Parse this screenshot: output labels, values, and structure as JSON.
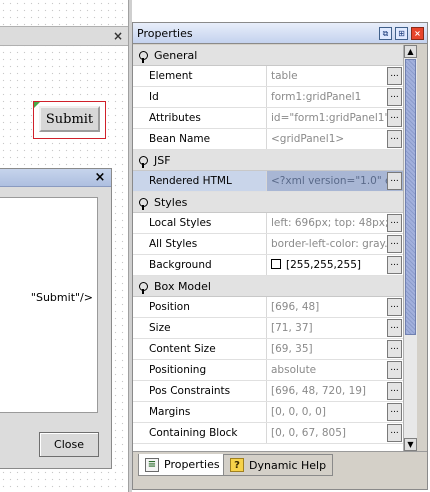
{
  "designer": {
    "close_glyph": "×",
    "submit_label": "Submit"
  },
  "dialog": {
    "close_glyph": "×",
    "code_text": "\"Submit\"/>",
    "close_button_label": "Close"
  },
  "panel": {
    "title": "Properties",
    "window_buttons": {
      "restore": "⧉",
      "float": "⊞",
      "close": "×"
    },
    "categories": [
      {
        "label": "General",
        "rows": [
          {
            "name": "Element",
            "value": "table"
          },
          {
            "name": "Id",
            "value": "form1:gridPanel1"
          },
          {
            "name": "Attributes",
            "value": "id=\"form1:gridPanel1\",..."
          },
          {
            "name": "Bean Name",
            "value": "<gridPanel1>"
          }
        ]
      },
      {
        "label": "JSF",
        "rows": [
          {
            "name": "Rendered HTML",
            "value": "<?xml version=\"1.0\" e..."
          }
        ]
      },
      {
        "label": "Styles",
        "rows": [
          {
            "name": "Local Styles",
            "value": "left: 696px; top: 48px; ..."
          },
          {
            "name": "All Styles",
            "value": "border-left-color: gray..."
          },
          {
            "name": "Background",
            "value": "[255,255,255]"
          }
        ]
      },
      {
        "label": "Box Model",
        "rows": [
          {
            "name": "Position",
            "value": "[696, 48]"
          },
          {
            "name": "Size",
            "value": "[71, 37]"
          },
          {
            "name": "Content Size",
            "value": "[69, 35]"
          },
          {
            "name": "Positioning",
            "value": "absolute"
          },
          {
            "name": "Pos Constraints",
            "value": "[696, 48, 720, 19]"
          },
          {
            "name": "Margins",
            "value": "[0, 0, 0, 0]"
          },
          {
            "name": "Containing Block",
            "value": "[0, 0, 67, 805]"
          }
        ]
      }
    ],
    "ellipsis": "...",
    "background_swatch_color": "#ffffff",
    "selected_row_color": "#a8b6d4",
    "scroll_up": "▲",
    "scroll_down": "▼"
  },
  "tabs": {
    "properties": "Properties",
    "dynamic_help": "Dynamic Help",
    "help_glyph": "?"
  }
}
